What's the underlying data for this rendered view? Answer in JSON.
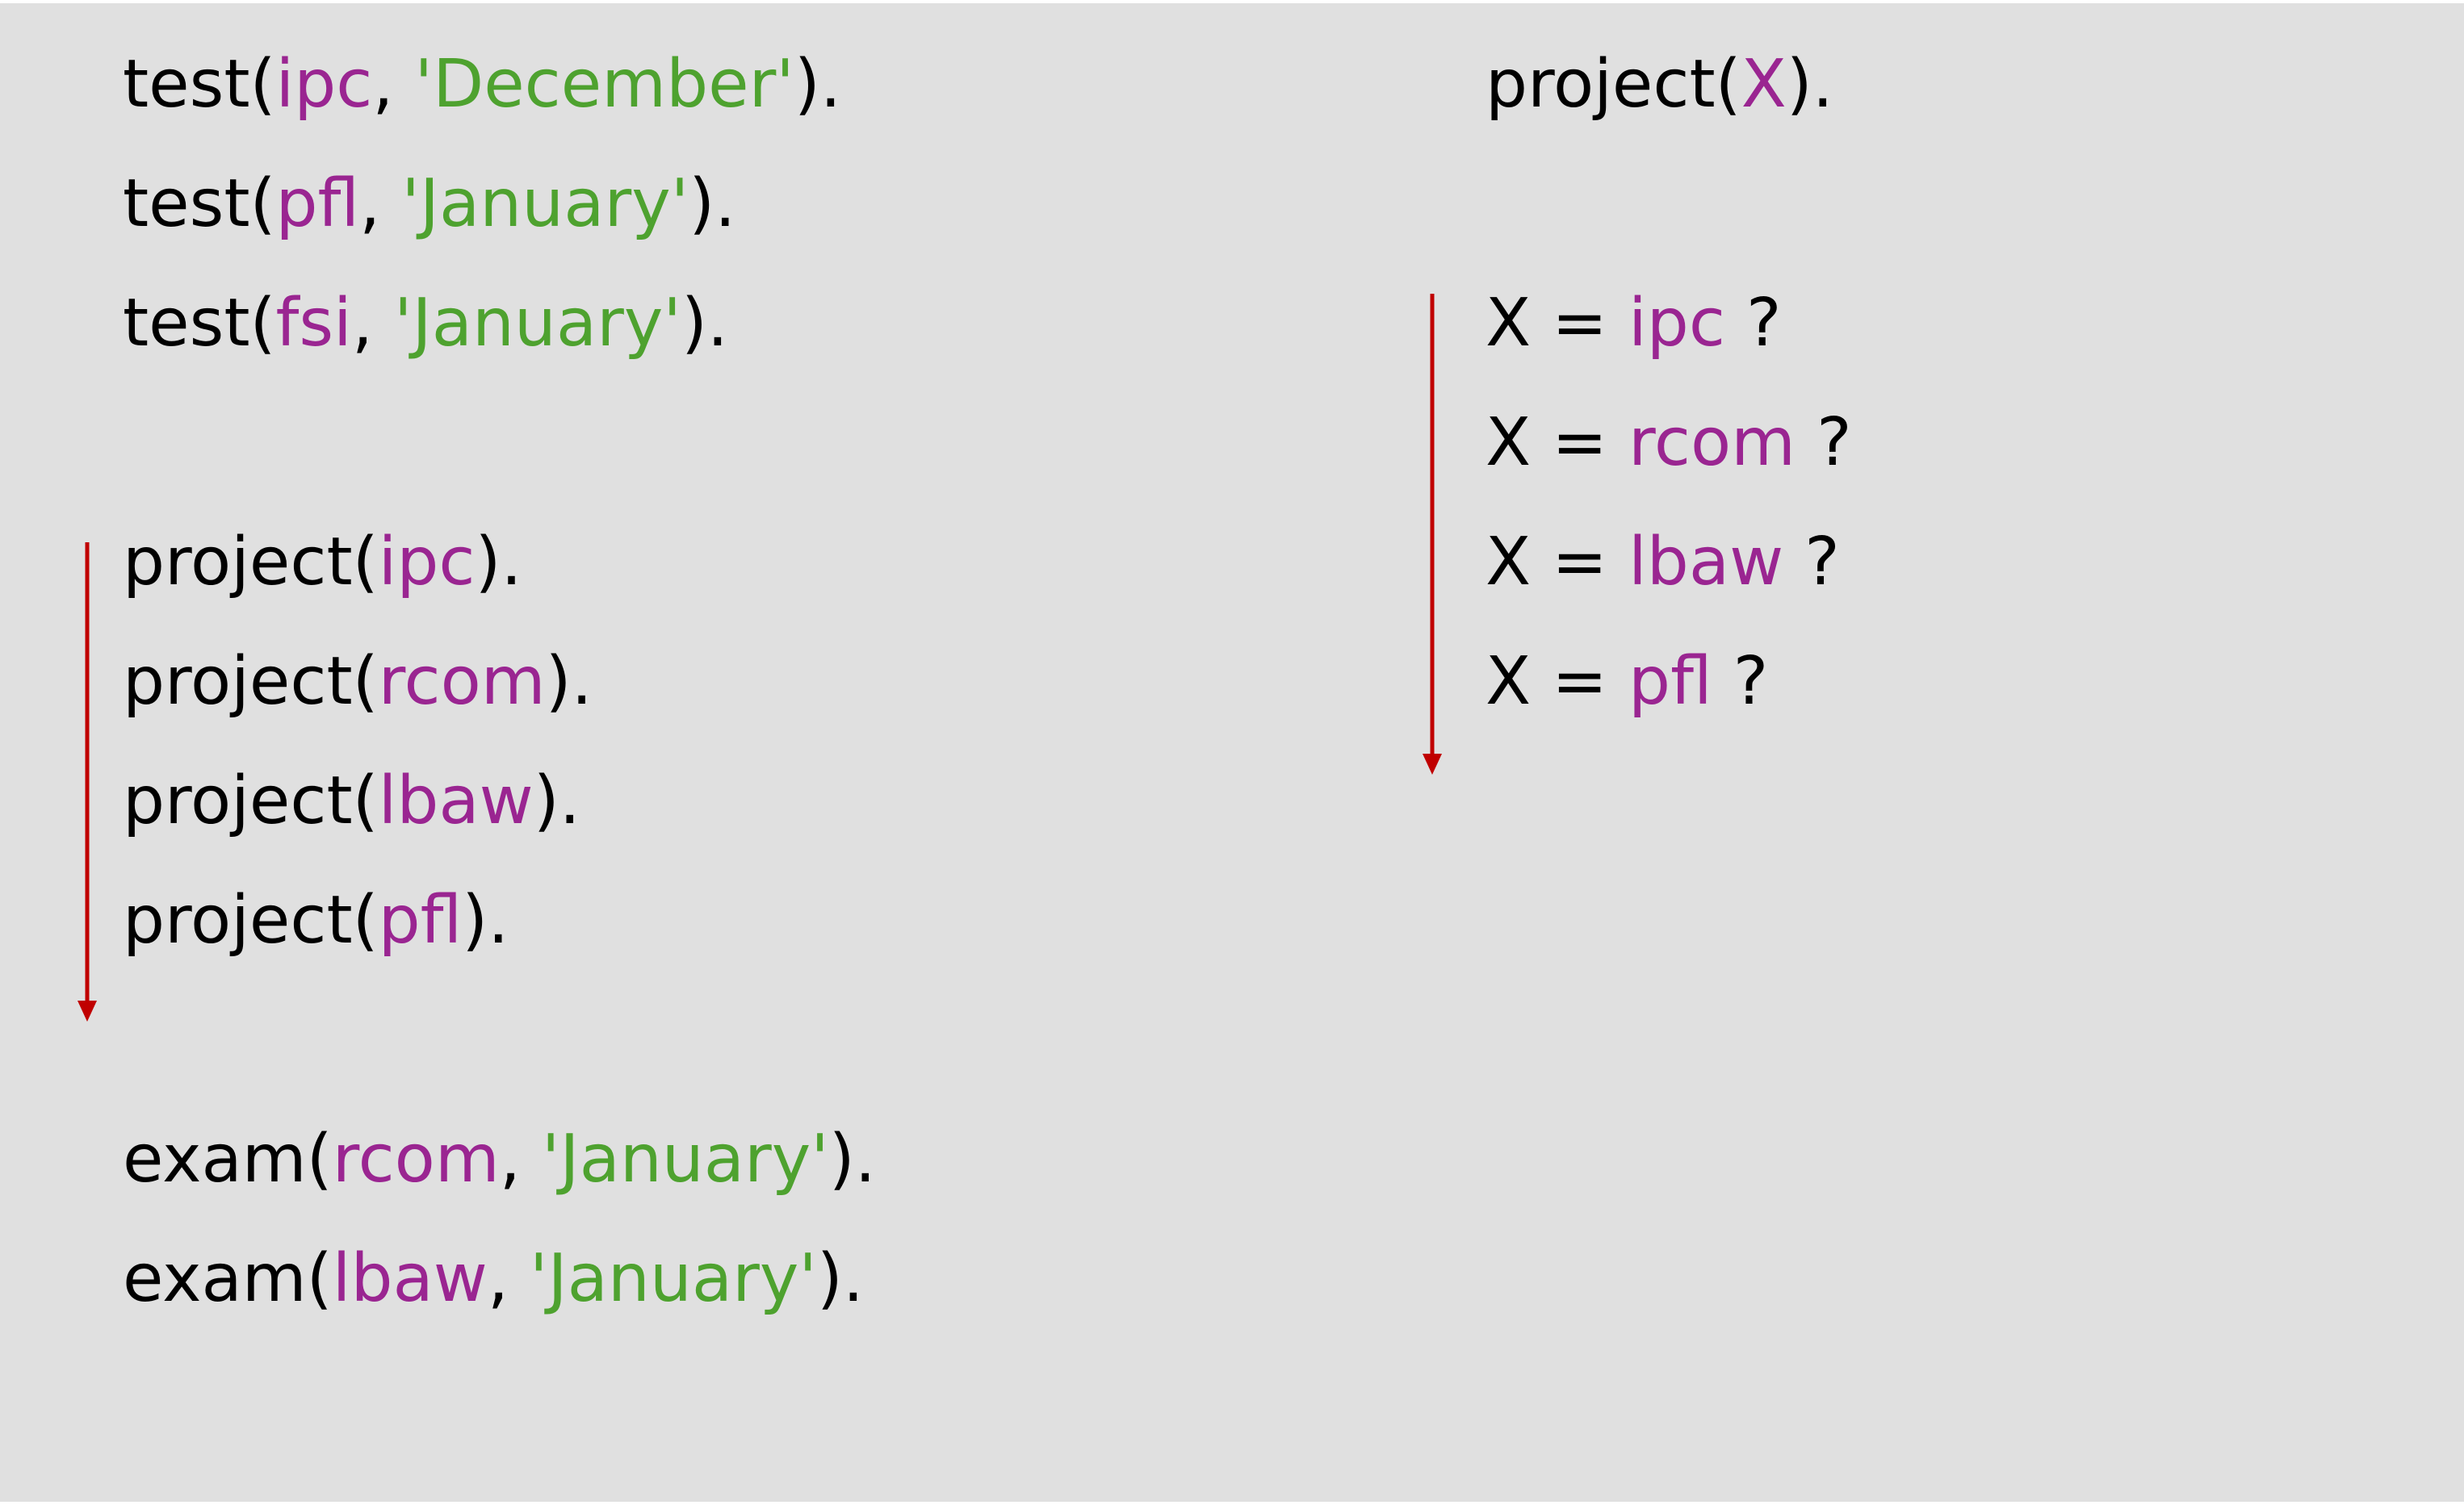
{
  "colors": {
    "background": "#e0e0e0",
    "atom": "#9a2591",
    "string": "#4ea22f",
    "variable": "#9a2591",
    "plain": "#000000",
    "arrow": "#c00000"
  },
  "left_column": {
    "tests": [
      [
        {
          "t": "test(",
          "k": "plain"
        },
        {
          "t": "ipc",
          "k": "atom"
        },
        {
          "t": ", ",
          "k": "plain"
        },
        {
          "t": "'December'",
          "k": "str"
        },
        {
          "t": ").",
          "k": "plain"
        }
      ],
      [
        {
          "t": "test(",
          "k": "plain"
        },
        {
          "t": "pfl",
          "k": "atom"
        },
        {
          "t": ", ",
          "k": "plain"
        },
        {
          "t": "'January'",
          "k": "str"
        },
        {
          "t": ").",
          "k": "plain"
        }
      ],
      [
        {
          "t": "test(",
          "k": "plain"
        },
        {
          "t": "fsi",
          "k": "atom"
        },
        {
          "t": ", ",
          "k": "plain"
        },
        {
          "t": "'January'",
          "k": "str"
        },
        {
          "t": ").",
          "k": "plain"
        }
      ]
    ],
    "projects": [
      [
        {
          "t": "project(",
          "k": "plain"
        },
        {
          "t": "ipc",
          "k": "atom"
        },
        {
          "t": ").",
          "k": "plain"
        }
      ],
      [
        {
          "t": "project(",
          "k": "plain"
        },
        {
          "t": "rcom",
          "k": "atom"
        },
        {
          "t": ").",
          "k": "plain"
        }
      ],
      [
        {
          "t": "project(",
          "k": "plain"
        },
        {
          "t": "lbaw",
          "k": "atom"
        },
        {
          "t": ").",
          "k": "plain"
        }
      ],
      [
        {
          "t": "project(",
          "k": "plain"
        },
        {
          "t": "pfl",
          "k": "atom"
        },
        {
          "t": ").",
          "k": "plain"
        }
      ]
    ],
    "exams": [
      [
        {
          "t": "exam(",
          "k": "plain"
        },
        {
          "t": "rcom",
          "k": "atom"
        },
        {
          "t": ", ",
          "k": "plain"
        },
        {
          "t": "'January'",
          "k": "str"
        },
        {
          "t": ").",
          "k": "plain"
        }
      ],
      [
        {
          "t": "exam(",
          "k": "plain"
        },
        {
          "t": "lbaw",
          "k": "atom"
        },
        {
          "t": ", ",
          "k": "plain"
        },
        {
          "t": "'January'",
          "k": "str"
        },
        {
          "t": ").",
          "k": "plain"
        }
      ]
    ]
  },
  "right_column": {
    "query": [
      {
        "t": "project(",
        "k": "plain"
      },
      {
        "t": "X",
        "k": "var"
      },
      {
        "t": ").",
        "k": "plain"
      }
    ],
    "attempts": [
      [
        {
          "t": "X = ",
          "k": "plain"
        },
        {
          "t": "ipc",
          "k": "atom"
        },
        {
          "t": " ?",
          "k": "plain"
        }
      ],
      [
        {
          "t": "X = ",
          "k": "plain"
        },
        {
          "t": "rcom",
          "k": "atom"
        },
        {
          "t": " ?",
          "k": "plain"
        }
      ],
      [
        {
          "t": "X = ",
          "k": "plain"
        },
        {
          "t": "lbaw",
          "k": "atom"
        },
        {
          "t": " ?",
          "k": "plain"
        }
      ],
      [
        {
          "t": "X = ",
          "k": "plain"
        },
        {
          "t": "pfl",
          "k": "atom"
        },
        {
          "t": " ?",
          "k": "plain"
        }
      ]
    ]
  }
}
